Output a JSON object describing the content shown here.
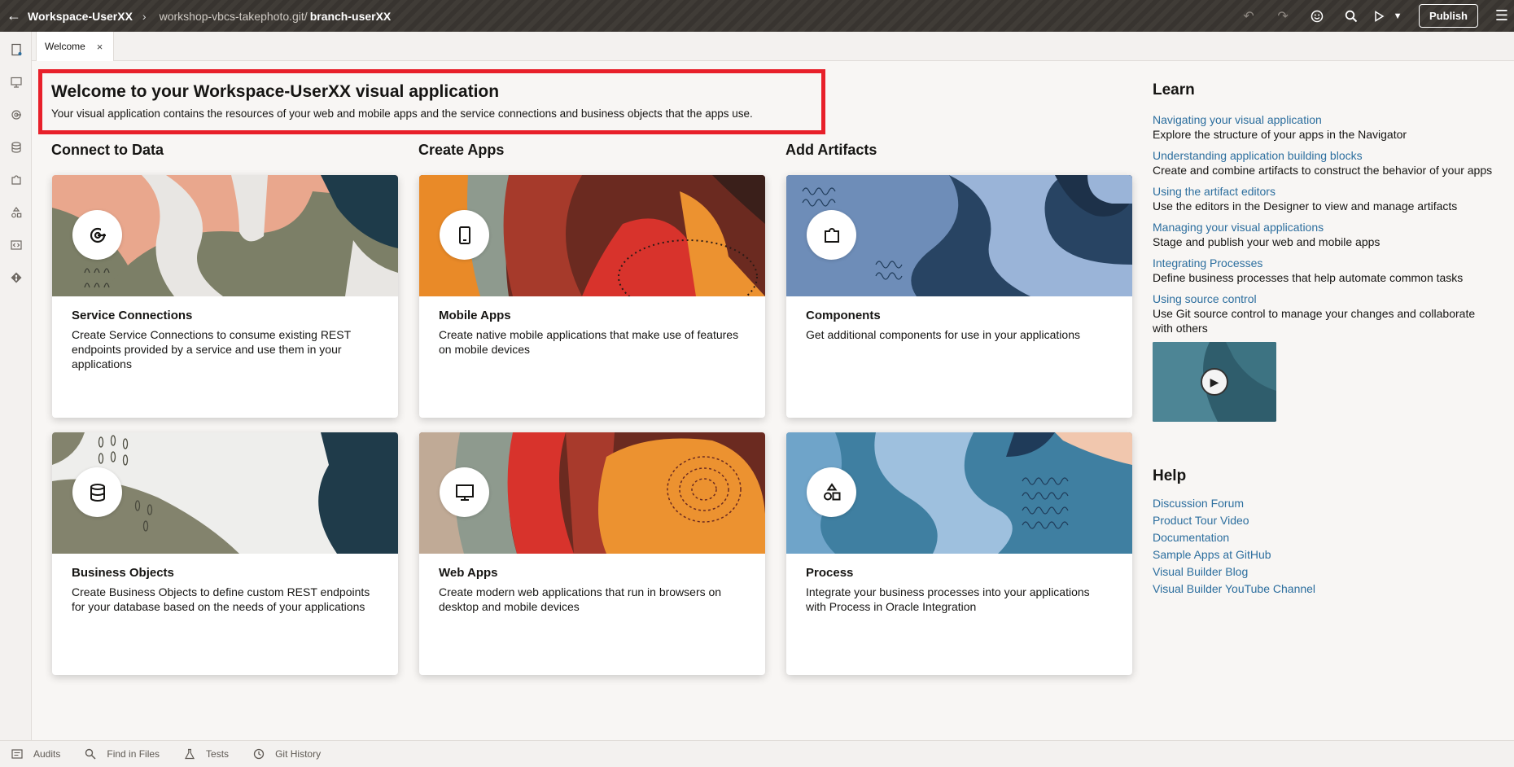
{
  "header": {
    "back_icon": "arrow-left-icon",
    "workspace": "Workspace-UserXX",
    "repo": "workshop-vbcs-takephoto.git/",
    "branch": "branch-userXX",
    "publish_label": "Publish"
  },
  "tab": {
    "label": "Welcome"
  },
  "welcome": {
    "title": "Welcome to your Workspace-UserXX visual application",
    "subtitle": "Your visual application contains the resources of your web and mobile apps and the service connections and business objects that the apps use."
  },
  "columns": {
    "connect": "Connect to Data",
    "create": "Create Apps",
    "add": "Add Artifacts"
  },
  "cards": [
    {
      "title": "Service Connections",
      "desc": "Create Service Connections to consume existing REST endpoints provided by a service and use them in your applications",
      "icon": "service-connection-icon"
    },
    {
      "title": "Mobile Apps",
      "desc": "Create native mobile applications that make use of features on mobile devices",
      "icon": "mobile-icon"
    },
    {
      "title": "Components",
      "desc": "Get additional components for use in your applications",
      "icon": "puzzle-icon"
    },
    {
      "title": "Business Objects",
      "desc": "Create Business Objects to define custom REST endpoints for your database based on the needs of your applications",
      "icon": "database-icon"
    },
    {
      "title": "Web Apps",
      "desc": "Create modern web applications that run in browsers on desktop and mobile devices",
      "icon": "desktop-icon"
    },
    {
      "title": "Process",
      "desc": "Integrate your business processes into your applications with Process in Oracle Integration",
      "icon": "shapes-icon"
    }
  ],
  "learn": {
    "title": "Learn",
    "items": [
      {
        "link": "Navigating your visual application",
        "desc": "Explore the structure of your apps in the Navigator"
      },
      {
        "link": "Understanding application building blocks",
        "desc": "Create and combine artifacts to construct the behavior of your apps"
      },
      {
        "link": "Using the artifact editors",
        "desc": "Use the editors in the Designer to view and manage artifacts"
      },
      {
        "link": "Managing your visual applications",
        "desc": "Stage and publish your web and mobile apps"
      },
      {
        "link": "Integrating Processes",
        "desc": "Define business processes that help automate common tasks"
      },
      {
        "link": "Using source control",
        "desc": "Use Git source control to manage your changes and collaborate with others"
      }
    ]
  },
  "help": {
    "title": "Help",
    "links": [
      "Discussion Forum",
      "Product Tour Video",
      "Documentation",
      "Sample Apps at GitHub",
      "Visual Builder Blog",
      "Visual Builder YouTube Channel"
    ]
  },
  "bottom": {
    "items": [
      "Audits",
      "Find in Files",
      "Tests",
      "Git History"
    ]
  },
  "colors": {
    "accent_link": "#2c6e9e",
    "highlight_border": "#e8202a",
    "topbar": "#3a3631"
  }
}
